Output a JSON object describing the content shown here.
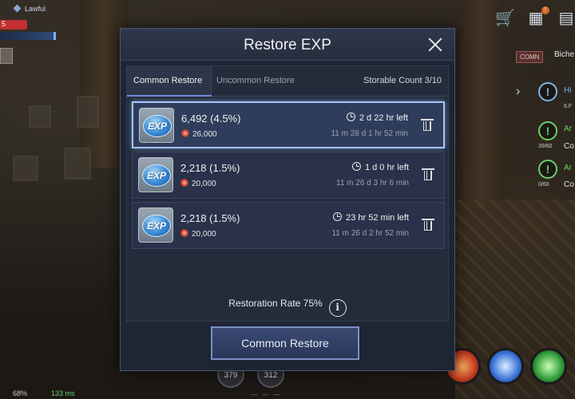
{
  "hud": {
    "character_name": "Lawful",
    "hp_label": "5",
    "battery": "68%",
    "ping": "133 ms",
    "quests": [
      {
        "title": "Hi",
        "sub": "6.F",
        "type": "blue"
      },
      {
        "title": "Ar",
        "sub": "39/60",
        "detail": "Co",
        "type": "green"
      },
      {
        "title": "Ar",
        "sub": "0/60",
        "detail": "Co",
        "type": "green"
      }
    ],
    "chat_tag": "COMN",
    "chat_name": "Biche",
    "slot_counts": [
      "379",
      "312"
    ],
    "cart_badge": "!"
  },
  "modal": {
    "title": "Restore EXP",
    "tabs": [
      {
        "label": "Common Restore",
        "active": true
      },
      {
        "label": "Uncommon Restore",
        "active": false
      }
    ],
    "storable_count": "Storable Count 3/10",
    "items": [
      {
        "icon_text": "EXP",
        "amount": "6,492 (4.5%)",
        "cost": "26,000",
        "time_left": "2 d 22 hr left",
        "expires": "11 m 28 d 1 hr 52 min",
        "selected": true
      },
      {
        "icon_text": "EXP",
        "amount": "2,218 (1.5%)",
        "cost": "20,000",
        "time_left": "1 d 0 hr left",
        "expires": "11 m 26 d 3 hr 6 min",
        "selected": false
      },
      {
        "icon_text": "EXP",
        "amount": "2,218 (1.5%)",
        "cost": "20,000",
        "time_left": "23 hr 52 min left",
        "expires": "11 m 26 d 2 hr 52 min",
        "selected": false
      }
    ],
    "restoration_rate": "Restoration Rate 75%",
    "info_glyph": "i",
    "restore_button": "Common Restore"
  },
  "colors": {
    "modal_bg": "#1e2533",
    "selected_border": "#a7c4ff",
    "button_bg": "#2a365a",
    "coin": "#c23a2a"
  }
}
